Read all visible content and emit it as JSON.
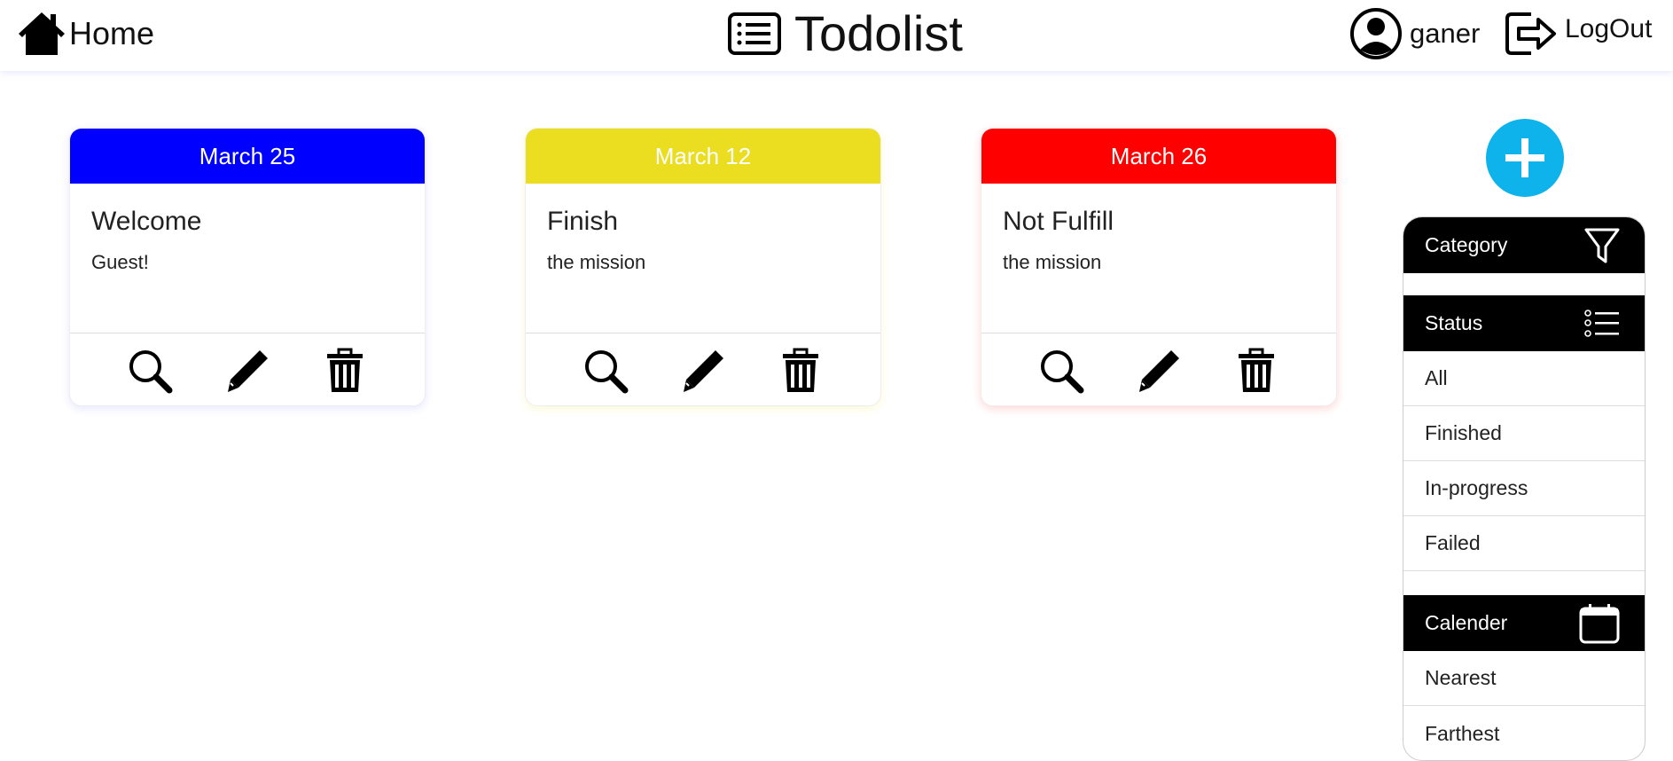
{
  "header": {
    "home_label": "Home",
    "app_title": "Todolist",
    "username": "ganer",
    "logout_label": "LogOut"
  },
  "cards": [
    {
      "date": "March 25",
      "title": "Welcome",
      "description": "Guest!",
      "color": "#0000ff"
    },
    {
      "date": "March 12",
      "title": "Finish",
      "description": "the mission",
      "color": "#ebdd20"
    },
    {
      "date": "March 26",
      "title": "Not Fulfill",
      "description": "the mission",
      "color": "#ff0000"
    }
  ],
  "card_actions": [
    "search-icon",
    "pencil-icon",
    "trash-icon"
  ],
  "add_button": {
    "icon": "plus-icon",
    "color": "#0fb3ec"
  },
  "filter_panel": {
    "category": {
      "label": "Category",
      "icon": "filter-icon"
    },
    "status": {
      "label": "Status",
      "icon": "list-icon",
      "options": [
        "All",
        "Finished",
        "In-progress",
        "Failed"
      ]
    },
    "calender": {
      "label": "Calender",
      "icon": "calendar-icon",
      "options": [
        "Nearest",
        "Farthest"
      ]
    }
  }
}
